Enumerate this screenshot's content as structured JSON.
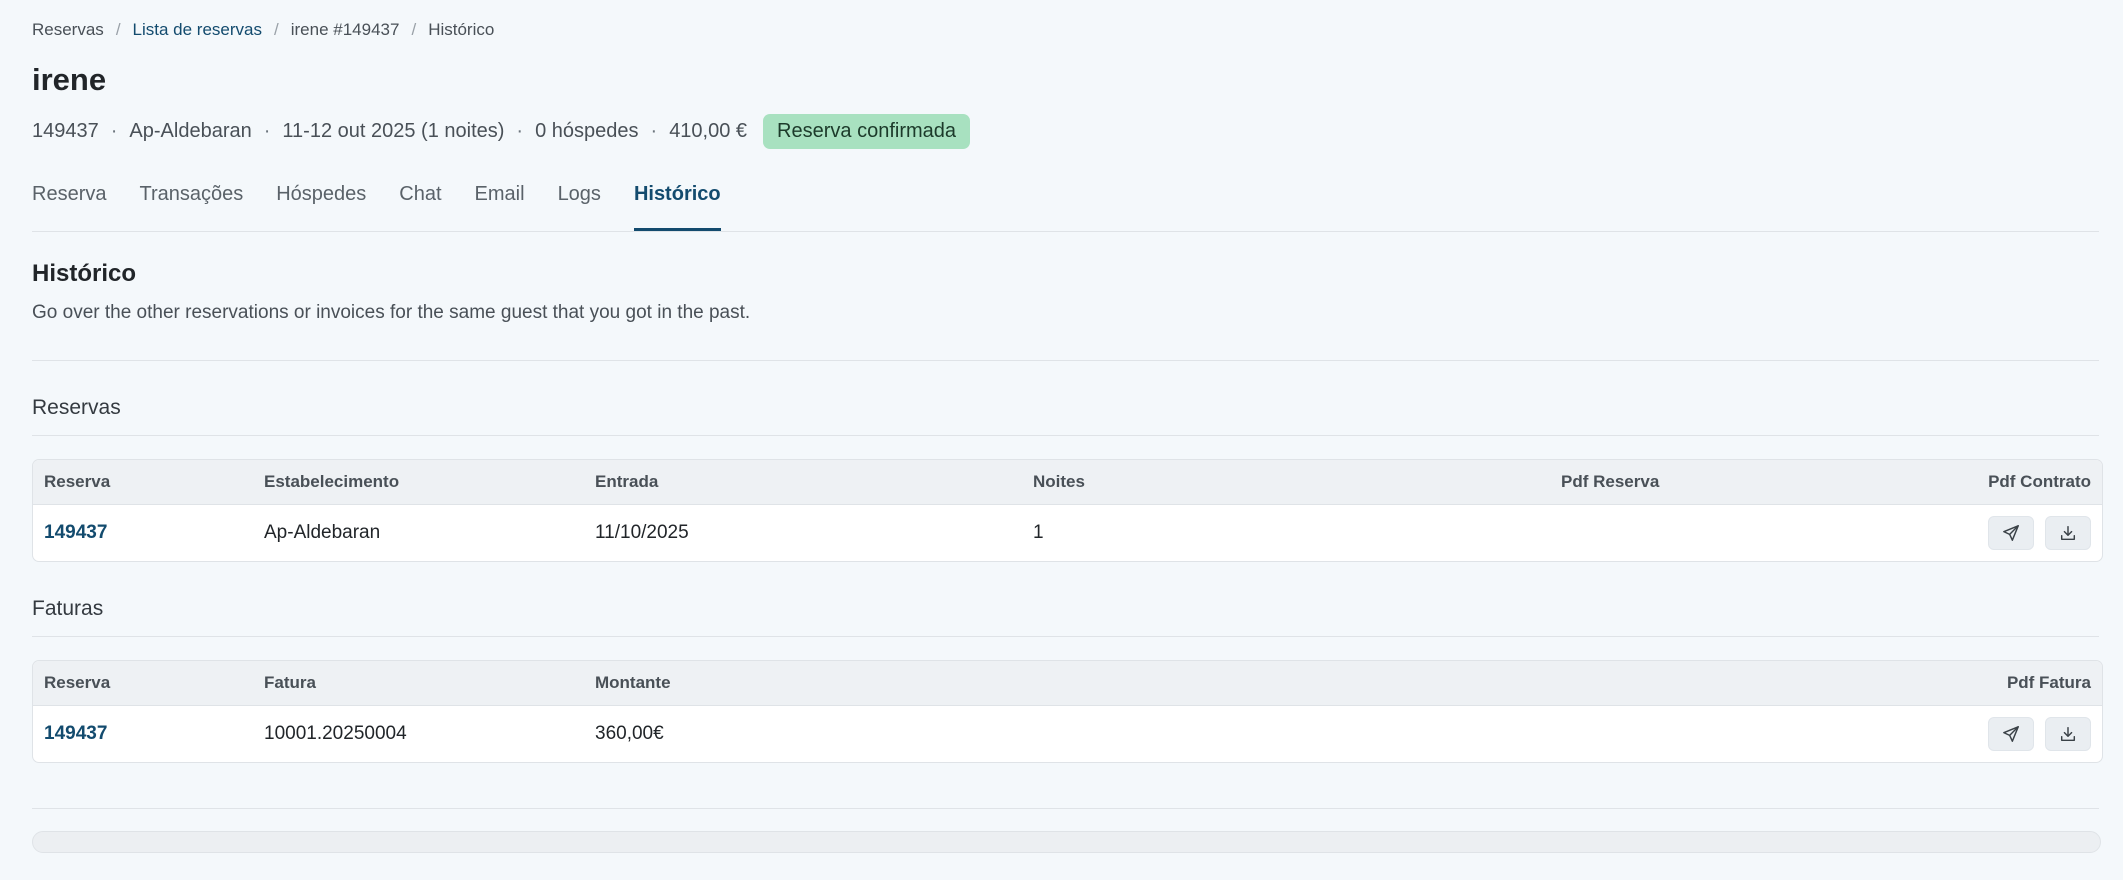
{
  "breadcrumb": {
    "items": [
      "Reservas",
      "Lista de reservas",
      "irene #149437",
      "Histórico"
    ],
    "separator": "/"
  },
  "header": {
    "title": "irene",
    "meta": [
      "149437",
      "Ap-Aldebaran",
      "11-12 out 2025 (1 noites)",
      "0 hóspedes",
      "410,00 €"
    ],
    "meta_separator": "·",
    "status_badge": "Reserva confirmada"
  },
  "tabs": [
    {
      "label": "Reserva"
    },
    {
      "label": "Transações"
    },
    {
      "label": "Hóspedes"
    },
    {
      "label": "Chat"
    },
    {
      "label": "Email"
    },
    {
      "label": "Logs"
    },
    {
      "label": "Histórico"
    }
  ],
  "active_tab": "Histórico",
  "section": {
    "title": "Histórico",
    "description": "Go over the other reservations or invoices for the same guest that you got in the past."
  },
  "reservations": {
    "title": "Reservas",
    "columns": [
      "Reserva",
      "Estabelecimento",
      "Entrada",
      "Noites",
      "Pdf Reserva",
      "Pdf Contrato"
    ],
    "rows": [
      {
        "reserva": "149437",
        "estabelecimento": "Ap-Aldebaran",
        "entrada": "11/10/2025",
        "noites": "1"
      }
    ]
  },
  "invoices": {
    "title": "Faturas",
    "columns": [
      "Reserva",
      "Fatura",
      "Montante",
      "Pdf Fatura"
    ],
    "rows": [
      {
        "reserva": "149437",
        "fatura": "10001.20250004",
        "montante": "360,00€"
      }
    ]
  },
  "icons": {
    "send": "send-icon",
    "download": "download-icon"
  },
  "colors": {
    "accent": "#134b6e",
    "badge_bg": "#a8e1c0",
    "background": "#f4f8fb"
  }
}
